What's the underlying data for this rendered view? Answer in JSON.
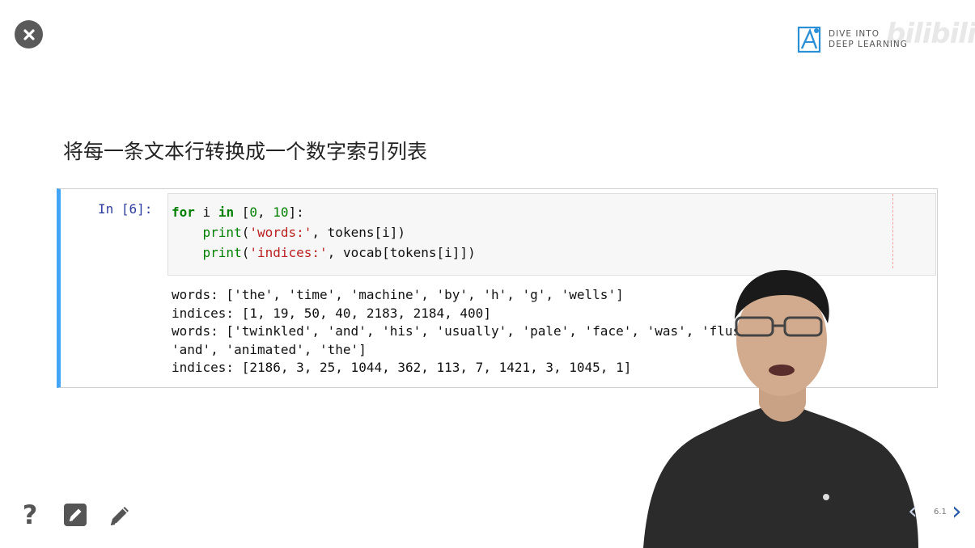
{
  "brand": {
    "logo_line1": "DIVE INTO",
    "logo_line2": "DEEP LEARNING",
    "watermark": "bilibili"
  },
  "slide": {
    "heading": "将每一条文本行转换成一个数字索引列表",
    "cell": {
      "prompt": "In [6]:",
      "code": {
        "line1_kw1": "for",
        "line1_var": " i ",
        "line1_kw2": "in",
        "line1_open": " [",
        "line1_n0": "0",
        "line1_sep": ", ",
        "line1_n1": "10",
        "line1_close": "]:",
        "line2_fn": "print",
        "line2_p": "(",
        "line2_str": "'words:'",
        "line2_rest": ", tokens[i])",
        "line3_fn": "print",
        "line3_p": "(",
        "line3_str": "'indices:'",
        "line3_rest": ", vocab[tokens[i]])"
      },
      "output": [
        "words: ['the', 'time', 'machine', 'by', 'h', 'g', 'wells']",
        "indices: [1, 19, 50, 40, 2183, 2184, 400]",
        "words: ['twinkled', 'and', 'his', 'usually', 'pale', 'face', 'was', 'flushed',",
        "'and', 'animated', 'the']",
        "indices: [2186, 3, 25, 1044, 362, 113, 7, 1421, 3, 1045, 1]"
      ]
    }
  },
  "tools": {
    "help_label": "?"
  },
  "navigation": {
    "slide_number": "6.1"
  },
  "colors": {
    "accent_border": "#42a5f5",
    "prompt": "#303f9f",
    "keyword": "#008000",
    "string": "#ba2121",
    "nav_next": "#2a5aa8"
  },
  "icons": [
    "close-icon",
    "logo-icon",
    "help-icon",
    "edit-box-icon",
    "pencil-icon",
    "chevron-left-icon",
    "chevron-right-icon"
  ]
}
